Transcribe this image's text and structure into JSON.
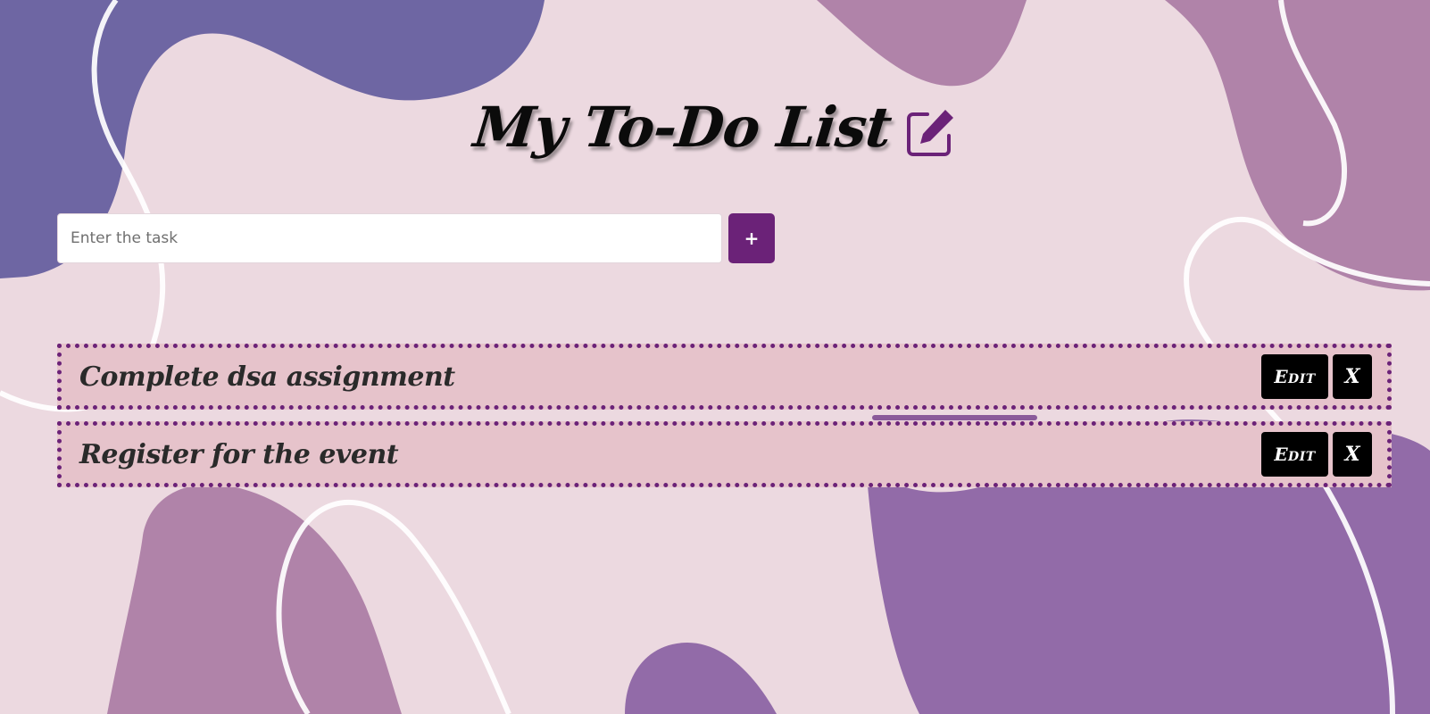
{
  "header": {
    "title": "My To-Do List",
    "title_icon": "edit-square-icon"
  },
  "add_task": {
    "placeholder": "Enter the task",
    "value": "",
    "add_label": "+"
  },
  "tasks": [
    {
      "text": "Complete dsa assignment",
      "edit_label": "Edit",
      "delete_label": "X"
    },
    {
      "text": "Register for the event",
      "edit_label": "Edit",
      "delete_label": "X"
    }
  ],
  "colors": {
    "background": "#ecd9e0",
    "accent": "#6b2278",
    "task_background": "#e6c3cb",
    "blob_dark": "#6e66a3",
    "blob_mauve": "#b083a9",
    "blob_violet": "#926ba8",
    "button_dark": "#000000"
  }
}
